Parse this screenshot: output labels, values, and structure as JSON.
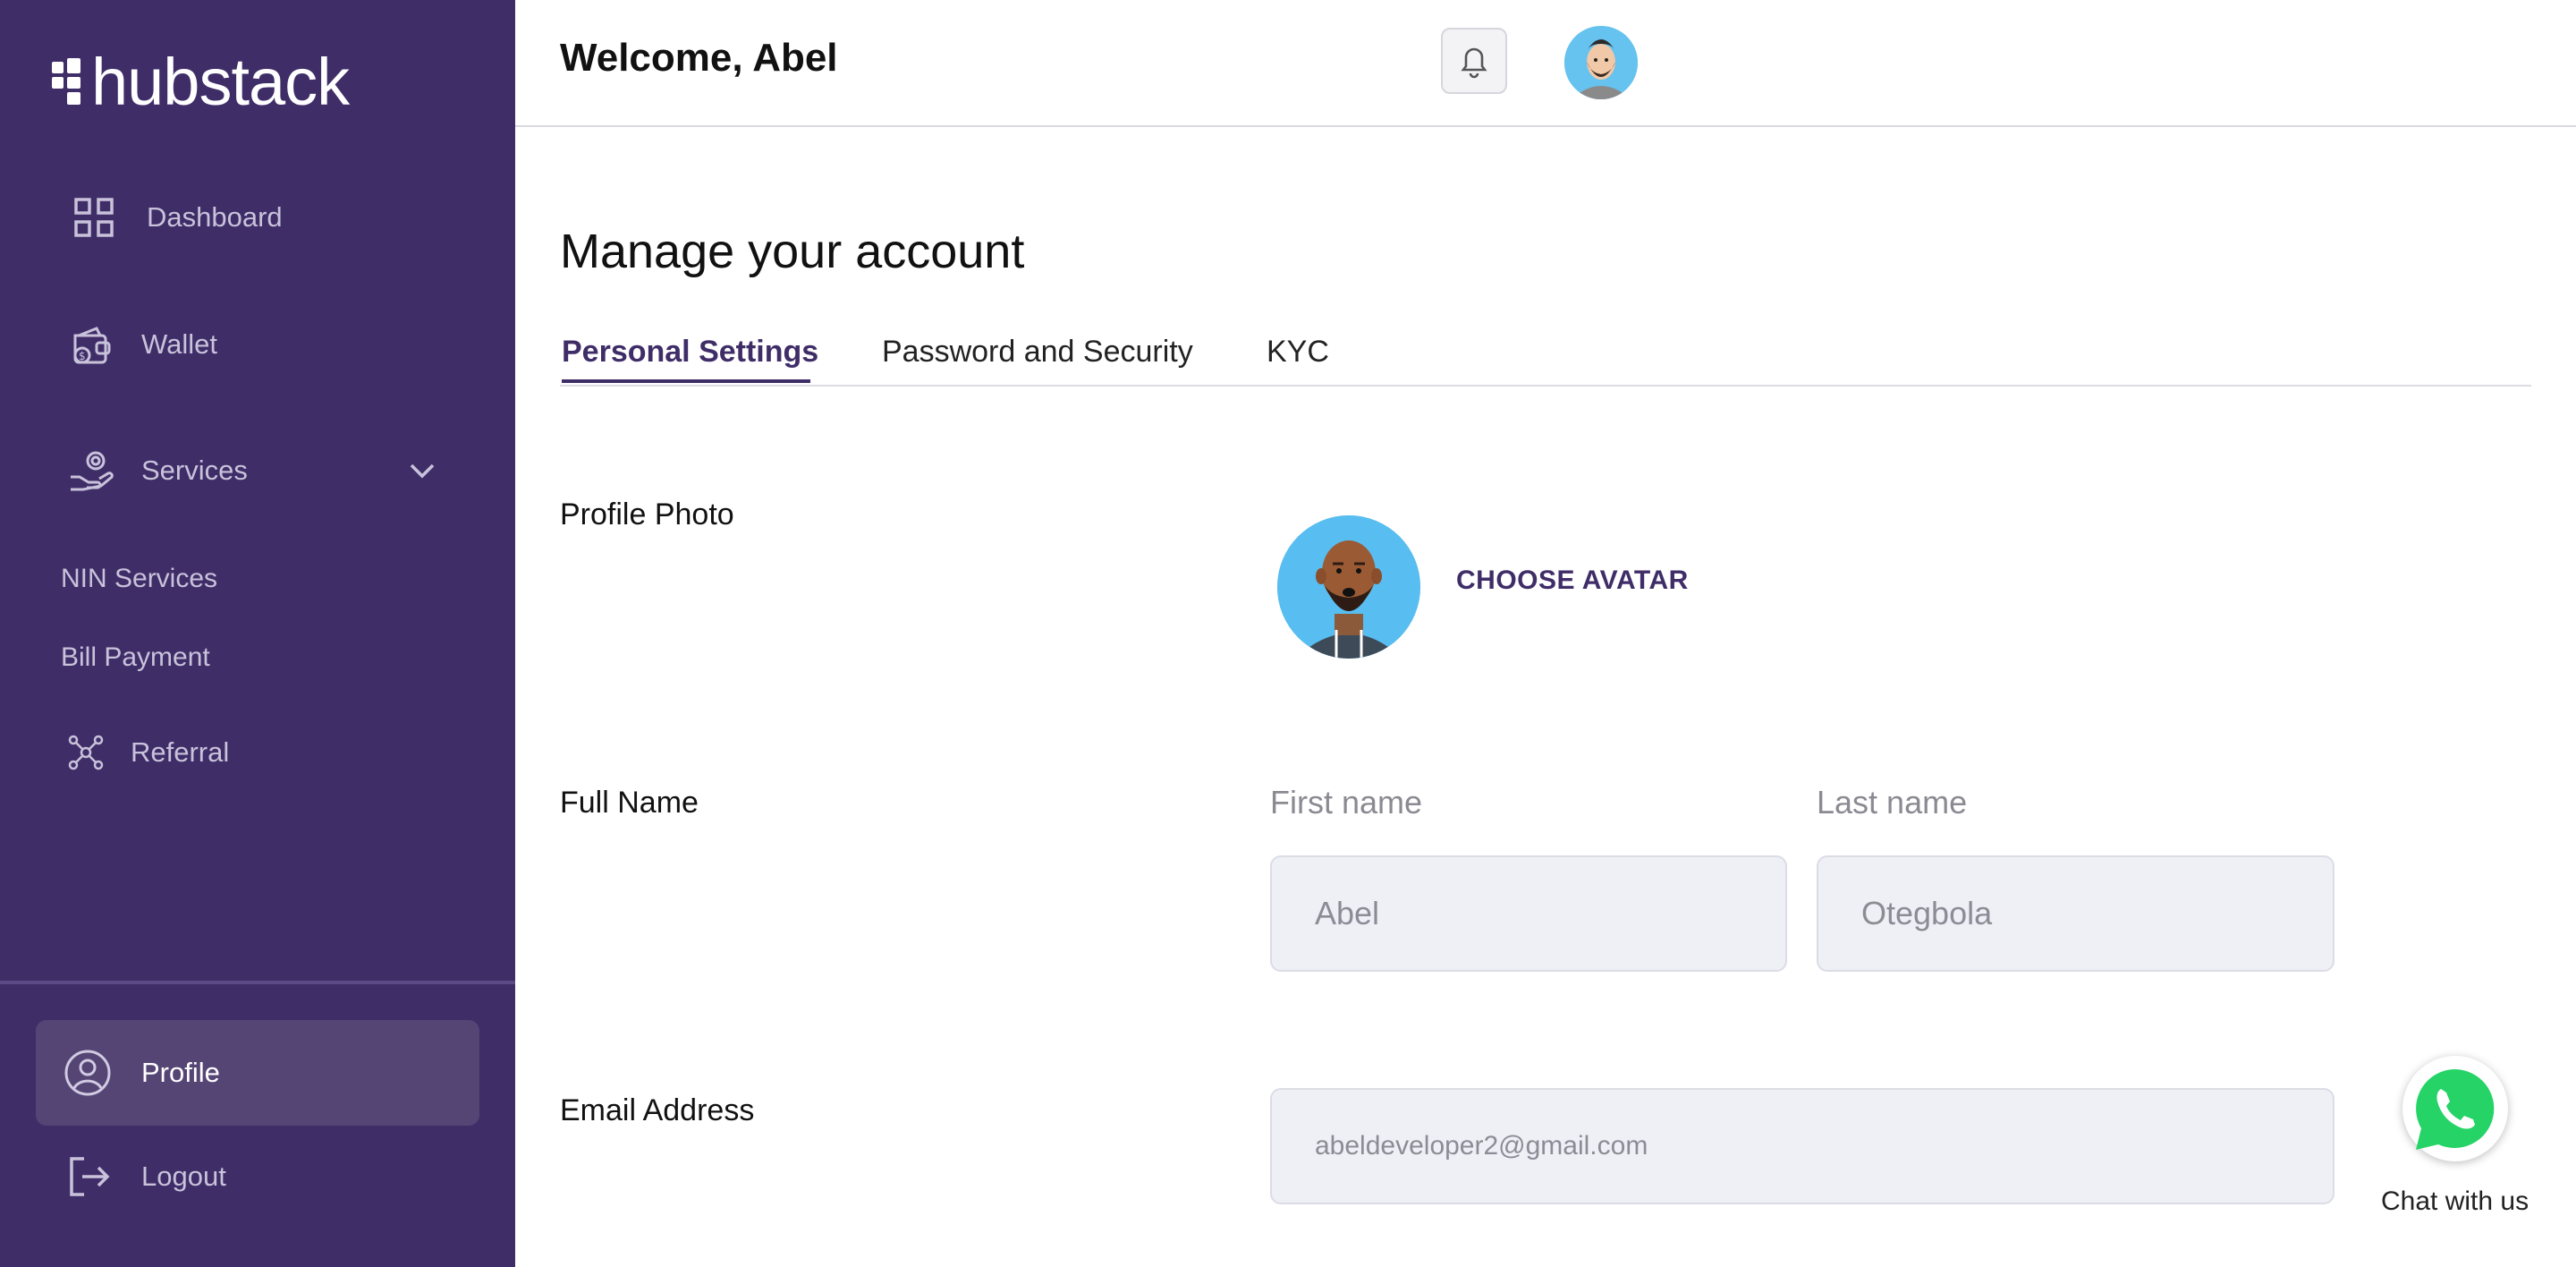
{
  "brand": {
    "name": "hubstack"
  },
  "sidebar": {
    "items": [
      {
        "label": "Dashboard",
        "icon": "grid-icon"
      },
      {
        "label": "Wallet",
        "icon": "wallet-icon"
      },
      {
        "label": "Services",
        "icon": "services-icon"
      },
      {
        "label": "NIN Services"
      },
      {
        "label": "Bill Payment"
      },
      {
        "label": "Referral",
        "icon": "referral-icon"
      }
    ],
    "profile": {
      "label": "Profile",
      "icon": "user-circle-icon"
    },
    "logout": {
      "label": "Logout",
      "icon": "logout-icon"
    }
  },
  "header": {
    "welcome": "Welcome, Abel"
  },
  "main": {
    "title": "Manage your account",
    "tabs": [
      {
        "label": "Personal Settings",
        "active": true
      },
      {
        "label": "Password and Security",
        "active": false
      },
      {
        "label": "KYC",
        "active": false
      }
    ],
    "profile_photo": {
      "label": "Profile Photo",
      "action": "CHOOSE AVATAR"
    },
    "full_name": {
      "label": "Full Name",
      "first_label": "First name",
      "first_value": "Abel",
      "last_label": "Last name",
      "last_value": "Otegbola"
    },
    "email": {
      "label": "Email Address",
      "value": "abeldeveloper2@gmail.com"
    }
  },
  "chat": {
    "label": "Chat with us"
  },
  "colors": {
    "sidebar": "#3f2d68",
    "accent": "#3f2d68",
    "whatsapp": "#25d366"
  }
}
